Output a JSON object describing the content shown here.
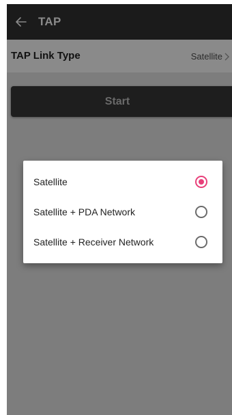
{
  "appbar": {
    "title": "TAP",
    "back_icon": "arrow-left-icon"
  },
  "link_type_row": {
    "label": "TAP Link Type",
    "value": "Satellite",
    "chevron_icon": "chevron-right-icon"
  },
  "start_button": {
    "label": "Start"
  },
  "dialog": {
    "options": [
      {
        "label": "Satellite",
        "selected": true
      },
      {
        "label": "Satellite + PDA Network",
        "selected": false
      },
      {
        "label": "Satellite + Receiver Network",
        "selected": false
      }
    ],
    "accent_color": "#e8407a"
  }
}
